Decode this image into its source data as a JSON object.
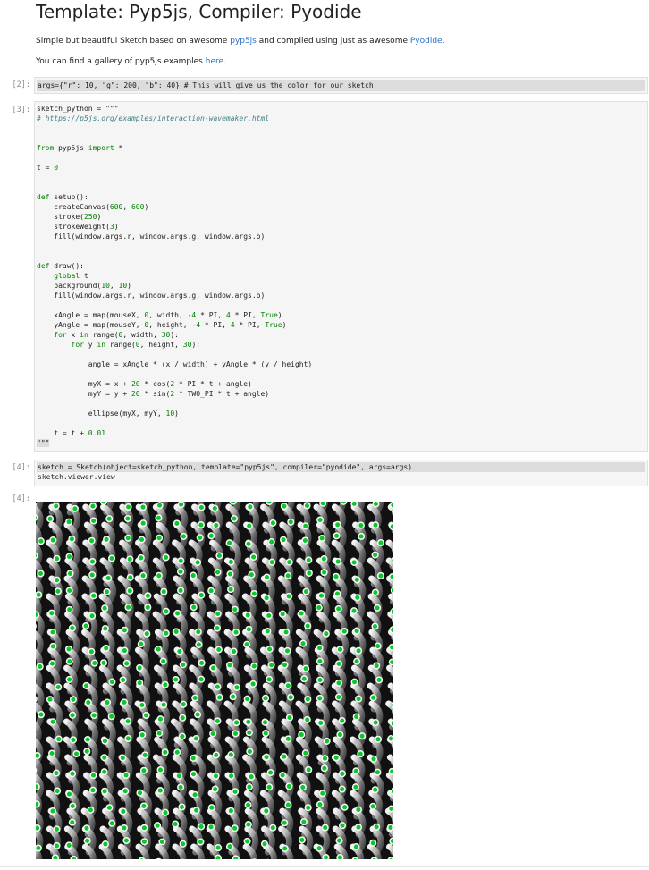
{
  "title": "Template: Pyp5js, Compiler: Pyodide",
  "intro": {
    "before": "Simple but beautiful Sketch based on awesome ",
    "link1": "pyp5js",
    "middle": " and compiled using just as awesome ",
    "link2": "Pyodide",
    "after": "."
  },
  "gallery": {
    "before": "You can find a gallery of pyp5js examples ",
    "link": "here",
    "after": "."
  },
  "cells": [
    {
      "prompt": "[2]:"
    },
    {
      "prompt": "[3]:"
    },
    {
      "prompt": "[4]:"
    },
    {
      "prompt": "[4]:"
    }
  ],
  "cell2_code": "args={\"r\": 10, \"g\": 200, \"b\": 40} # This will give us the color for our sketch",
  "cell3_code": [
    "sketch_python = \"\"\"",
    "# https://p5js.org/examples/interaction-wavemaker.html",
    "",
    "",
    "from pyp5js import *",
    "",
    "t = 0",
    "",
    "",
    "def setup():",
    "    createCanvas(600, 600)",
    "    stroke(250)",
    "    strokeWeight(3)",
    "    fill(window.args.r, window.args.g, window.args.b)",
    "",
    "",
    "def draw():",
    "    global t",
    "    background(10, 10)",
    "    fill(window.args.r, window.args.g, window.args.b)",
    "",
    "    xAngle = map(mouseX, 0, width, -4 * PI, 4 * PI, True)",
    "    yAngle = map(mouseY, 0, height, -4 * PI, 4 * PI, True)",
    "    for x in range(0, width, 30):",
    "        for y in range(0, height, 30):",
    "",
    "            angle = xAngle * (x / width) + yAngle * (y / height)",
    "",
    "            myX = x + 20 * cos(2 * PI * t + angle)",
    "            myY = y + 20 * sin(2 * TWO_PI * t + angle)",
    "",
    "            ellipse(myX, myY, 10)",
    "",
    "    t = t + 0.01",
    "\"\"\""
  ],
  "cell4_line1": "sketch = Sketch(object=sketch_python, template=\"pyp5js\", compiler=\"pyodide\", args=args)",
  "cell4_line2": "sketch.viewer.view",
  "sketch_colors": {
    "background": "#111111",
    "stroke": "#fafafa",
    "fill": "#0ac828"
  }
}
